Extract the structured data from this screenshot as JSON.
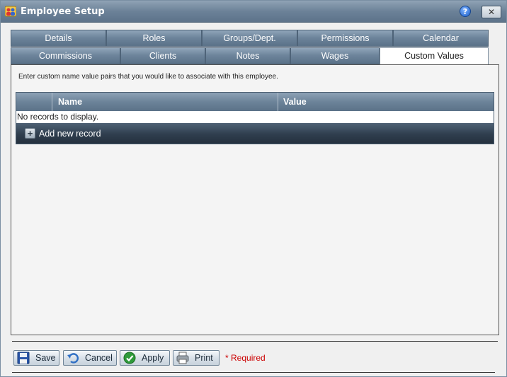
{
  "window": {
    "title": "Employee Setup"
  },
  "titlebar": {
    "help_label": "?",
    "close_label": "✕"
  },
  "tabs_row1": [
    "Details",
    "Roles",
    "Groups/Dept.",
    "Permissions",
    "Calendar"
  ],
  "tabs_row2": [
    "Commissions",
    "Clients",
    "Notes",
    "Wages",
    "Custom Values"
  ],
  "active_tab": "Custom Values",
  "content": {
    "description": "Enter custom name value pairs that you would like to associate with this employee."
  },
  "grid": {
    "columns": [
      "",
      "Name",
      "Value"
    ],
    "empty_text": "No records to display.",
    "add_label": "Add new record",
    "add_icon": "+"
  },
  "footer": {
    "buttons": [
      {
        "label": "Save",
        "icon": "floppy-icon"
      },
      {
        "label": "Cancel",
        "icon": "undo-icon"
      },
      {
        "label": "Apply",
        "icon": "check-icon"
      },
      {
        "label": "Print",
        "icon": "printer-icon"
      }
    ],
    "required_text": "* Required"
  },
  "colors": {
    "header": "#6c8399",
    "footer_grid": "#2f3e4e",
    "required": "#cc0000"
  }
}
